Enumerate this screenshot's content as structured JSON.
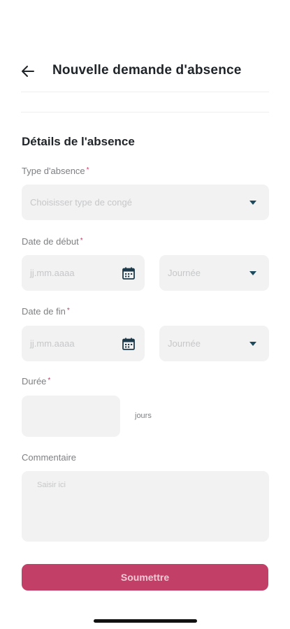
{
  "header": {
    "title": "Nouvelle demande d'absence",
    "back_icon": "arrow-left-icon"
  },
  "section": {
    "title": "Détails de l'absence"
  },
  "form": {
    "type": {
      "label": "Type d'absence",
      "required_mark": "*",
      "placeholder": "Choisisser type de congé"
    },
    "start_date": {
      "label": "Date de début",
      "required_mark": "*",
      "placeholder": "jj.mm.aaaa",
      "period_placeholder": "Journée"
    },
    "end_date": {
      "label": "Date de fin",
      "required_mark": "*",
      "placeholder": "jj.mm.aaaa",
      "period_placeholder": "Journée"
    },
    "duration": {
      "label": "Durée",
      "required_mark": "*",
      "unit": "jours"
    },
    "comment": {
      "label": "Commentaire",
      "placeholder": "Saisir ici"
    },
    "submit_label": "Soumettre"
  },
  "colors": {
    "accent": "#c23f68",
    "caret": "#1c4a5c",
    "field_bg": "#f2f2f2"
  }
}
